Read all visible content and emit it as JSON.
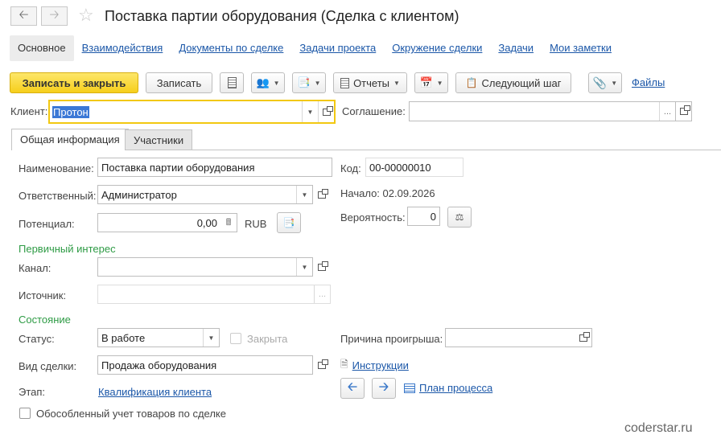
{
  "window": {
    "title": "Поставка партии оборудования (Сделка с клиентом)"
  },
  "nav": {
    "tabs": [
      {
        "label": "Основное"
      },
      {
        "label": "Взаимодействия"
      },
      {
        "label": "Документы по сделке"
      },
      {
        "label": "Задачи проекта"
      },
      {
        "label": "Окружение сделки"
      },
      {
        "label": "Задачи"
      },
      {
        "label": "Мои заметки"
      }
    ]
  },
  "toolbar": {
    "save_close": "Записать и закрыть",
    "save": "Записать",
    "reports": "Отчеты",
    "next_step": "Следующий шаг",
    "files": "Файлы"
  },
  "client": {
    "label": "Клиент:",
    "value": "Протон"
  },
  "agreement": {
    "label": "Соглашение:",
    "value": ""
  },
  "tabs": {
    "general": "Общая информация",
    "participants": "Участники"
  },
  "form": {
    "name_label": "Наименование:",
    "name_value": "Поставка партии оборудования",
    "code_label": "Код:",
    "code_value": "00-00000010",
    "responsible_label": "Ответственный:",
    "responsible_value": "Администратор",
    "start_text": "Начало: 02.09.2026",
    "potential_label": "Потенциал:",
    "potential_value": "0,00",
    "currency": "RUB",
    "probability_label": "Вероятность:",
    "probability_value": "0",
    "primary_interest": "Первичный интерес",
    "channel_label": "Канал:",
    "channel_value": "",
    "source_label": "Источник:",
    "source_value": "",
    "state_group": "Состояние",
    "status_label": "Статус:",
    "status_value": "В работе",
    "closed_label": "Закрыта",
    "loss_reason_label": "Причина проигрыша:",
    "loss_reason_value": "",
    "deal_type_label": "Вид сделки:",
    "deal_type_value": "Продажа оборудования",
    "instructions": "Инструкции",
    "stage_label": "Этап:",
    "stage_value": "Квалификация клиента",
    "process_plan": "План процесса",
    "separate_accounting": "Обособленный учет товаров по сделке"
  },
  "watermark": "coderstar.ru",
  "colors": {
    "primary_button": "#f6cf1b",
    "link": "#1b57a8",
    "group": "#2e9b45",
    "selection": "#3b78d6"
  }
}
